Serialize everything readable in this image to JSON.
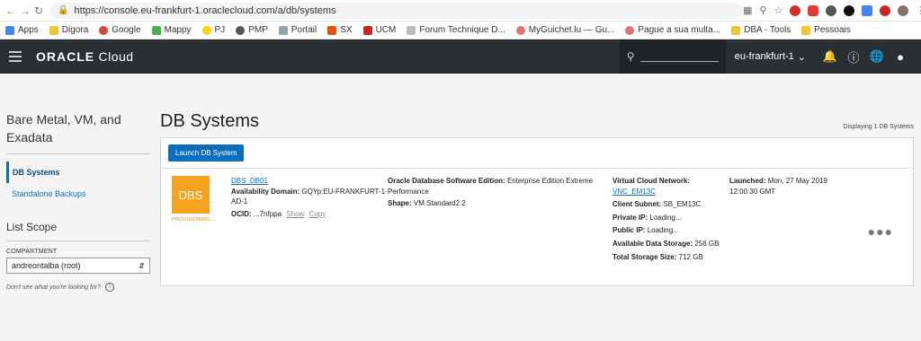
{
  "browser": {
    "url": "https://console.eu-frankfurt-1.oraclecloud.com/a/db/systems",
    "bookmarks": [
      "Apps",
      "Digora",
      "Google",
      "Mappy",
      "PJ",
      "PMP",
      "Portail",
      "SX",
      "UCM",
      "Forum Technique D...",
      "MyGuichet.lu — Gu...",
      "Pague a sua multa...",
      "DBA - Tools",
      "Pessoais"
    ]
  },
  "header": {
    "logo_brand": "ORACLE",
    "logo_suffix": "Cloud",
    "region": "eu-frankfurt-1"
  },
  "sidebar": {
    "title": "Bare Metal, VM, and Exadata",
    "items": [
      {
        "label": "DB Systems",
        "active": true
      },
      {
        "label": "Standalone Backups",
        "active": false
      }
    ],
    "scope_title": "List Scope",
    "compartment_label": "COMPARTMENT",
    "compartment_value": "andreontalba (root)",
    "help_text": "Don't see what you're looking for?"
  },
  "main": {
    "title": "DB Systems",
    "display_count": "Displaying 1 DB Systems",
    "launch_button": "Launch DB System",
    "row": {
      "icon_text": "DBS",
      "status": "PROVISIONING...",
      "name": "DBS_DB01",
      "ad_label": "Availability Domain:",
      "ad_value": "GQYp:EU-FRANKFURT-1-AD-1",
      "ocid_label": "OCID:",
      "ocid_value": "...7nfppa",
      "ocid_show": "Show",
      "ocid_copy": "Copy",
      "edition_label": "Oracle Database Software Edition:",
      "edition_value": "Enterprise Edition Extreme Performance",
      "shape_label": "Shape:",
      "shape_value": "VM.Standard2.2",
      "vcn_label": "Virtual Cloud Network:",
      "vcn_value": "VNC_EM13C",
      "subnet_label": "Client Subnet:",
      "subnet_value": "SB_EM13C",
      "private_ip_label": "Private IP:",
      "private_ip_value": "Loading...",
      "public_ip_label": "Public IP:",
      "public_ip_value": "Loading...",
      "data_storage_label": "Available Data Storage:",
      "data_storage_value": "256 GB",
      "total_storage_label": "Total Storage Size:",
      "total_storage_value": "712 GB",
      "launched_label": "Launched:",
      "launched_value": "Mon, 27 May 2019 12:00:30 GMT"
    }
  }
}
